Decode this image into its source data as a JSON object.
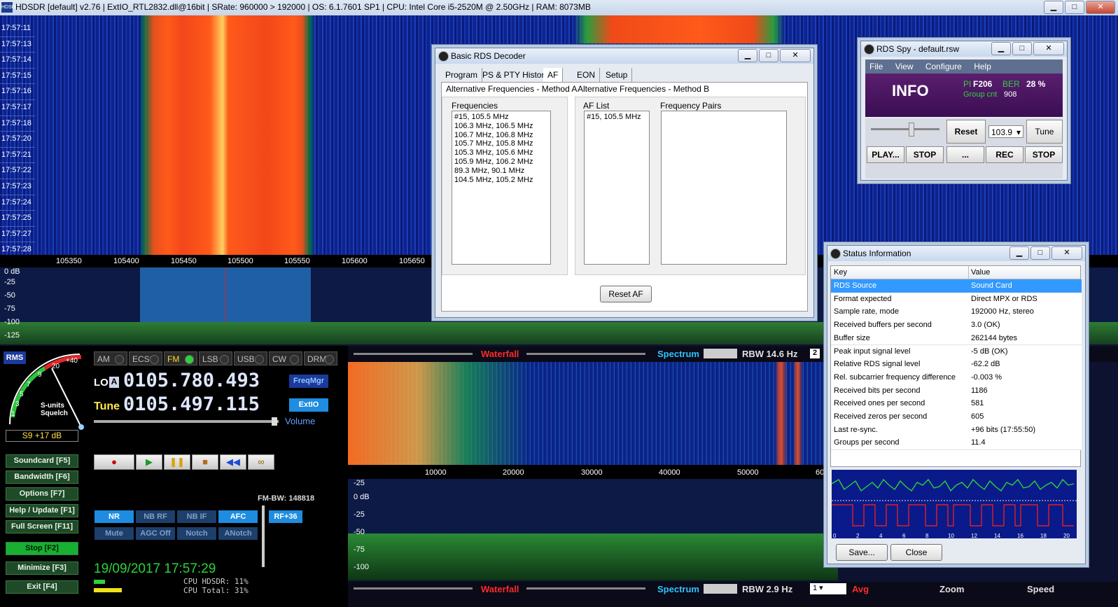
{
  "titlebar": {
    "text": "HDSDR  [default]  v2.76   |  ExtIO_RTL2832.dll@16bit  |  SRate: 960000 > 192000  |  OS: 6.1.7601 SP1  |  CPU: Intel Core i5-2520M @ 2.50GHz  |  RAM: 8073MB",
    "logo": "HDSDR",
    "min": "▁",
    "max": "□",
    "close": "✕"
  },
  "waterfall_times": [
    "17:57:11",
    "17:57:13",
    "17:57:14",
    "17:57:15",
    "17:57:16",
    "17:57:17",
    "17:57:18",
    "17:57:20",
    "17:57:21",
    "17:57:22",
    "17:57:23",
    "17:57:24",
    "17:57:25",
    "17:57:27",
    "17:57:28"
  ],
  "freq_axis": [
    "105350",
    "105400",
    "105450",
    "105500",
    "105550",
    "105600",
    "105650"
  ],
  "spectrum_top": {
    "db_labels": [
      "0 dB",
      "-25",
      "-50",
      "-75",
      "-100",
      "-125"
    ]
  },
  "rds_decoder": {
    "title": "Basic RDS Decoder",
    "tabs": [
      "Program",
      "PS & PTY History",
      "AF",
      "EON",
      "Setup"
    ],
    "active_tab": "AF",
    "method_a": "Alternative Frequencies - Method A",
    "method_b": "Alternative Frequencies - Method B",
    "freq_label": "Frequencies",
    "frequencies": [
      "#15, 105.5 MHz",
      "106.3 MHz, 106.5 MHz",
      "106.7 MHz, 106.8 MHz",
      "105.7 MHz, 105.8 MHz",
      "105.3 MHz, 105.6 MHz",
      "105.9 MHz, 106.2 MHz",
      "89.3 MHz, 90.1 MHz",
      "104.5 MHz, 105.2 MHz"
    ],
    "af_list_label": "AF List",
    "af_list": [
      "#15, 105.5 MHz"
    ],
    "pairs_label": "Frequency Pairs",
    "reset_label": "Reset AF"
  },
  "rds_spy": {
    "title": "RDS Spy - default.rsw",
    "menu": [
      "File",
      "View",
      "Configure",
      "Help"
    ],
    "info": "INFO",
    "pi_label": "PI",
    "pi_value": "F206",
    "ber_label": "BER",
    "ber_value": "28 %",
    "group_label": "Group cnt",
    "group_value": "908",
    "reset": "Reset",
    "freq": "103.9",
    "tune": "Tune",
    "play": "PLAY...",
    "stop1": "STOP",
    "dots": "...",
    "rec": "REC",
    "stop2": "STOP"
  },
  "status_info": {
    "title": "Status Information",
    "col_key": "Key",
    "col_value": "Value",
    "rows": [
      {
        "k": "RDS Source",
        "v": "Sound Card"
      },
      {
        "k": "Format expected",
        "v": "Direct MPX or RDS"
      },
      {
        "k": "Sample rate, mode",
        "v": "192000 Hz, stereo"
      },
      {
        "k": "Received buffers per second",
        "v": "3.0 (OK)"
      },
      {
        "k": "Buffer size",
        "v": "262144 bytes"
      },
      {
        "k": "Peak input signal level",
        "v": "-5 dB (OK)"
      },
      {
        "k": "Relative RDS signal level",
        "v": "-62.2 dB"
      },
      {
        "k": "Rel. subcarrier frequency difference",
        "v": "-0.003 %"
      },
      {
        "k": "Received bits per second",
        "v": "1186"
      },
      {
        "k": "Received ones per second",
        "v": "581"
      },
      {
        "k": "Received zeros per second",
        "v": "605"
      },
      {
        "k": "Last re-sync.",
        "v": "+96 bits (17:55:50)"
      },
      {
        "k": "Groups per second",
        "v": "11.4"
      }
    ],
    "scope_ticks": [
      "0",
      "2",
      "4",
      "6",
      "8",
      "10",
      "12",
      "14",
      "16",
      "18",
      "20"
    ],
    "save": "Save...",
    "close": "Close"
  },
  "panel": {
    "rms": "RMS",
    "smeter_scale": [
      "+40",
      "20",
      "9",
      "7",
      "5",
      "3",
      "1"
    ],
    "smeter_caption_1": "S-units",
    "smeter_caption_2": "Squelch",
    "smeter_reading": "S9 +17 dB",
    "modes": [
      "AM",
      "ECSS",
      "FM",
      "LSB",
      "USB",
      "CW",
      "DRM"
    ],
    "active_mode": "FM",
    "lo_label": "LO",
    "lo_a": "A",
    "lo_freq": "0105.780.493",
    "tune_label": "Tune",
    "tune_freq": "0105.497.115",
    "freqmgr": "FreqMgr",
    "extio": "ExtIO",
    "volume": "Volume",
    "side_buttons": [
      "Soundcard  [F5]",
      "Bandwidth  [F6]",
      "Options     [F7]",
      "Help / Update  [F1]",
      "Full Screen  [F11]",
      "Stop       [F2]",
      "Minimize  [F3]",
      "Exit       [F4]"
    ],
    "fm_bw": "FM-BW: 148818",
    "dsp_row1": [
      "NR",
      "NB RF",
      "NB IF",
      "AFC"
    ],
    "dsp_row2": [
      "Mute",
      "AGC Off",
      "Notch",
      "ANotch"
    ],
    "rf": "RF+36",
    "datetime": "19/09/2017 17:57:29",
    "cpu_hdsdr": "CPU HDSDR:  11%",
    "cpu_total": "CPU Total:  31%"
  },
  "bottom": {
    "waterfall": "Waterfall",
    "spectrum": "Spectrum",
    "rbw_top": "RBW 14.6 Hz",
    "rbw_top_n": "2",
    "axis": [
      "10000",
      "20000",
      "30000",
      "40000",
      "50000",
      "60"
    ],
    "db_labels": [
      "-25",
      "0 dB",
      "-25",
      "-50",
      "-75",
      "-100"
    ],
    "rbw_bottom": "RBW  2.9 Hz",
    "select_val": "1",
    "avg": "Avg",
    "zoom": "Zoom",
    "speed": "Speed"
  }
}
